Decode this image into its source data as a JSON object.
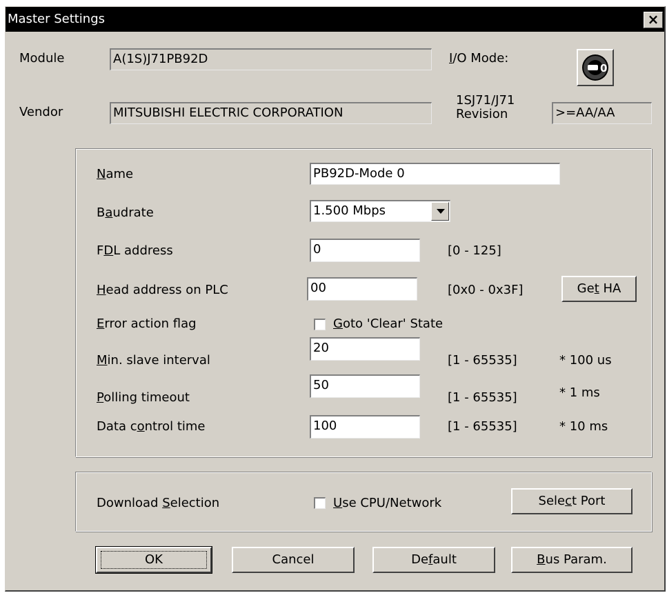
{
  "window": {
    "title": "Master Settings",
    "close_glyph": "×"
  },
  "info": {
    "module_label": "Module",
    "module_value": "A(1S)J71PB92D",
    "vendor_label": "Vendor",
    "vendor_value": "MITSUBISHI ELECTRIC CORPORATION",
    "io_mode_label": "I/O Mode:",
    "io_mode_value": "0",
    "revision_label_line1": "1SJ71/J71",
    "revision_label_line2": "Revision",
    "revision_value": ">=AA/AA"
  },
  "params": {
    "name": {
      "label": "Name",
      "mnemonic": "N",
      "rest": "ame",
      "value": "PB92D-Mode 0"
    },
    "baudrate": {
      "pre": "B",
      "mnemonic": "a",
      "rest": "udrate",
      "value": "1.500 Mbps"
    },
    "fdl": {
      "pre": "F",
      "mnemonic": "D",
      "rest": "L address",
      "value": "0",
      "range": "[0 - 125]"
    },
    "head": {
      "mnemonic": "H",
      "rest": "ead address on PLC",
      "value": "00",
      "range": "[0x0 - 0x3F]",
      "button_pre": "Ge",
      "button_mnemonic": "t",
      "button_rest": " HA"
    },
    "error_flag": {
      "mnemonic": "E",
      "rest": "rror action flag",
      "check_mnemonic": "G",
      "check_rest": "oto 'Clear' State",
      "checked": false
    },
    "min_slave": {
      "mnemonic": "M",
      "rest": "in. slave interval",
      "value": "20",
      "range": "[1 - 65535]",
      "unit": "* 100 us"
    },
    "polling": {
      "mnemonic": "P",
      "rest": "olling timeout",
      "value": "50",
      "range": "[1 - 65535]",
      "unit": "* 1 ms"
    },
    "data_control": {
      "pre": "Data c",
      "mnemonic": "o",
      "rest": "ntrol time",
      "value": "100",
      "range": "[1 - 65535]",
      "unit": "* 10 ms"
    }
  },
  "download": {
    "pre": "Download ",
    "mnemonic": "S",
    "rest": "election",
    "check_mnemonic": "U",
    "check_rest": "se CPU/Network",
    "checked": false,
    "button_pre": "Sele",
    "button_mnemonic": "c",
    "button_rest": "t Port"
  },
  "buttons": {
    "ok": "OK",
    "cancel": "Cancel",
    "default_pre": "De",
    "default_mnemonic": "f",
    "default_rest": "ault",
    "bus_mnemonic": "B",
    "bus_rest": "us Param."
  }
}
